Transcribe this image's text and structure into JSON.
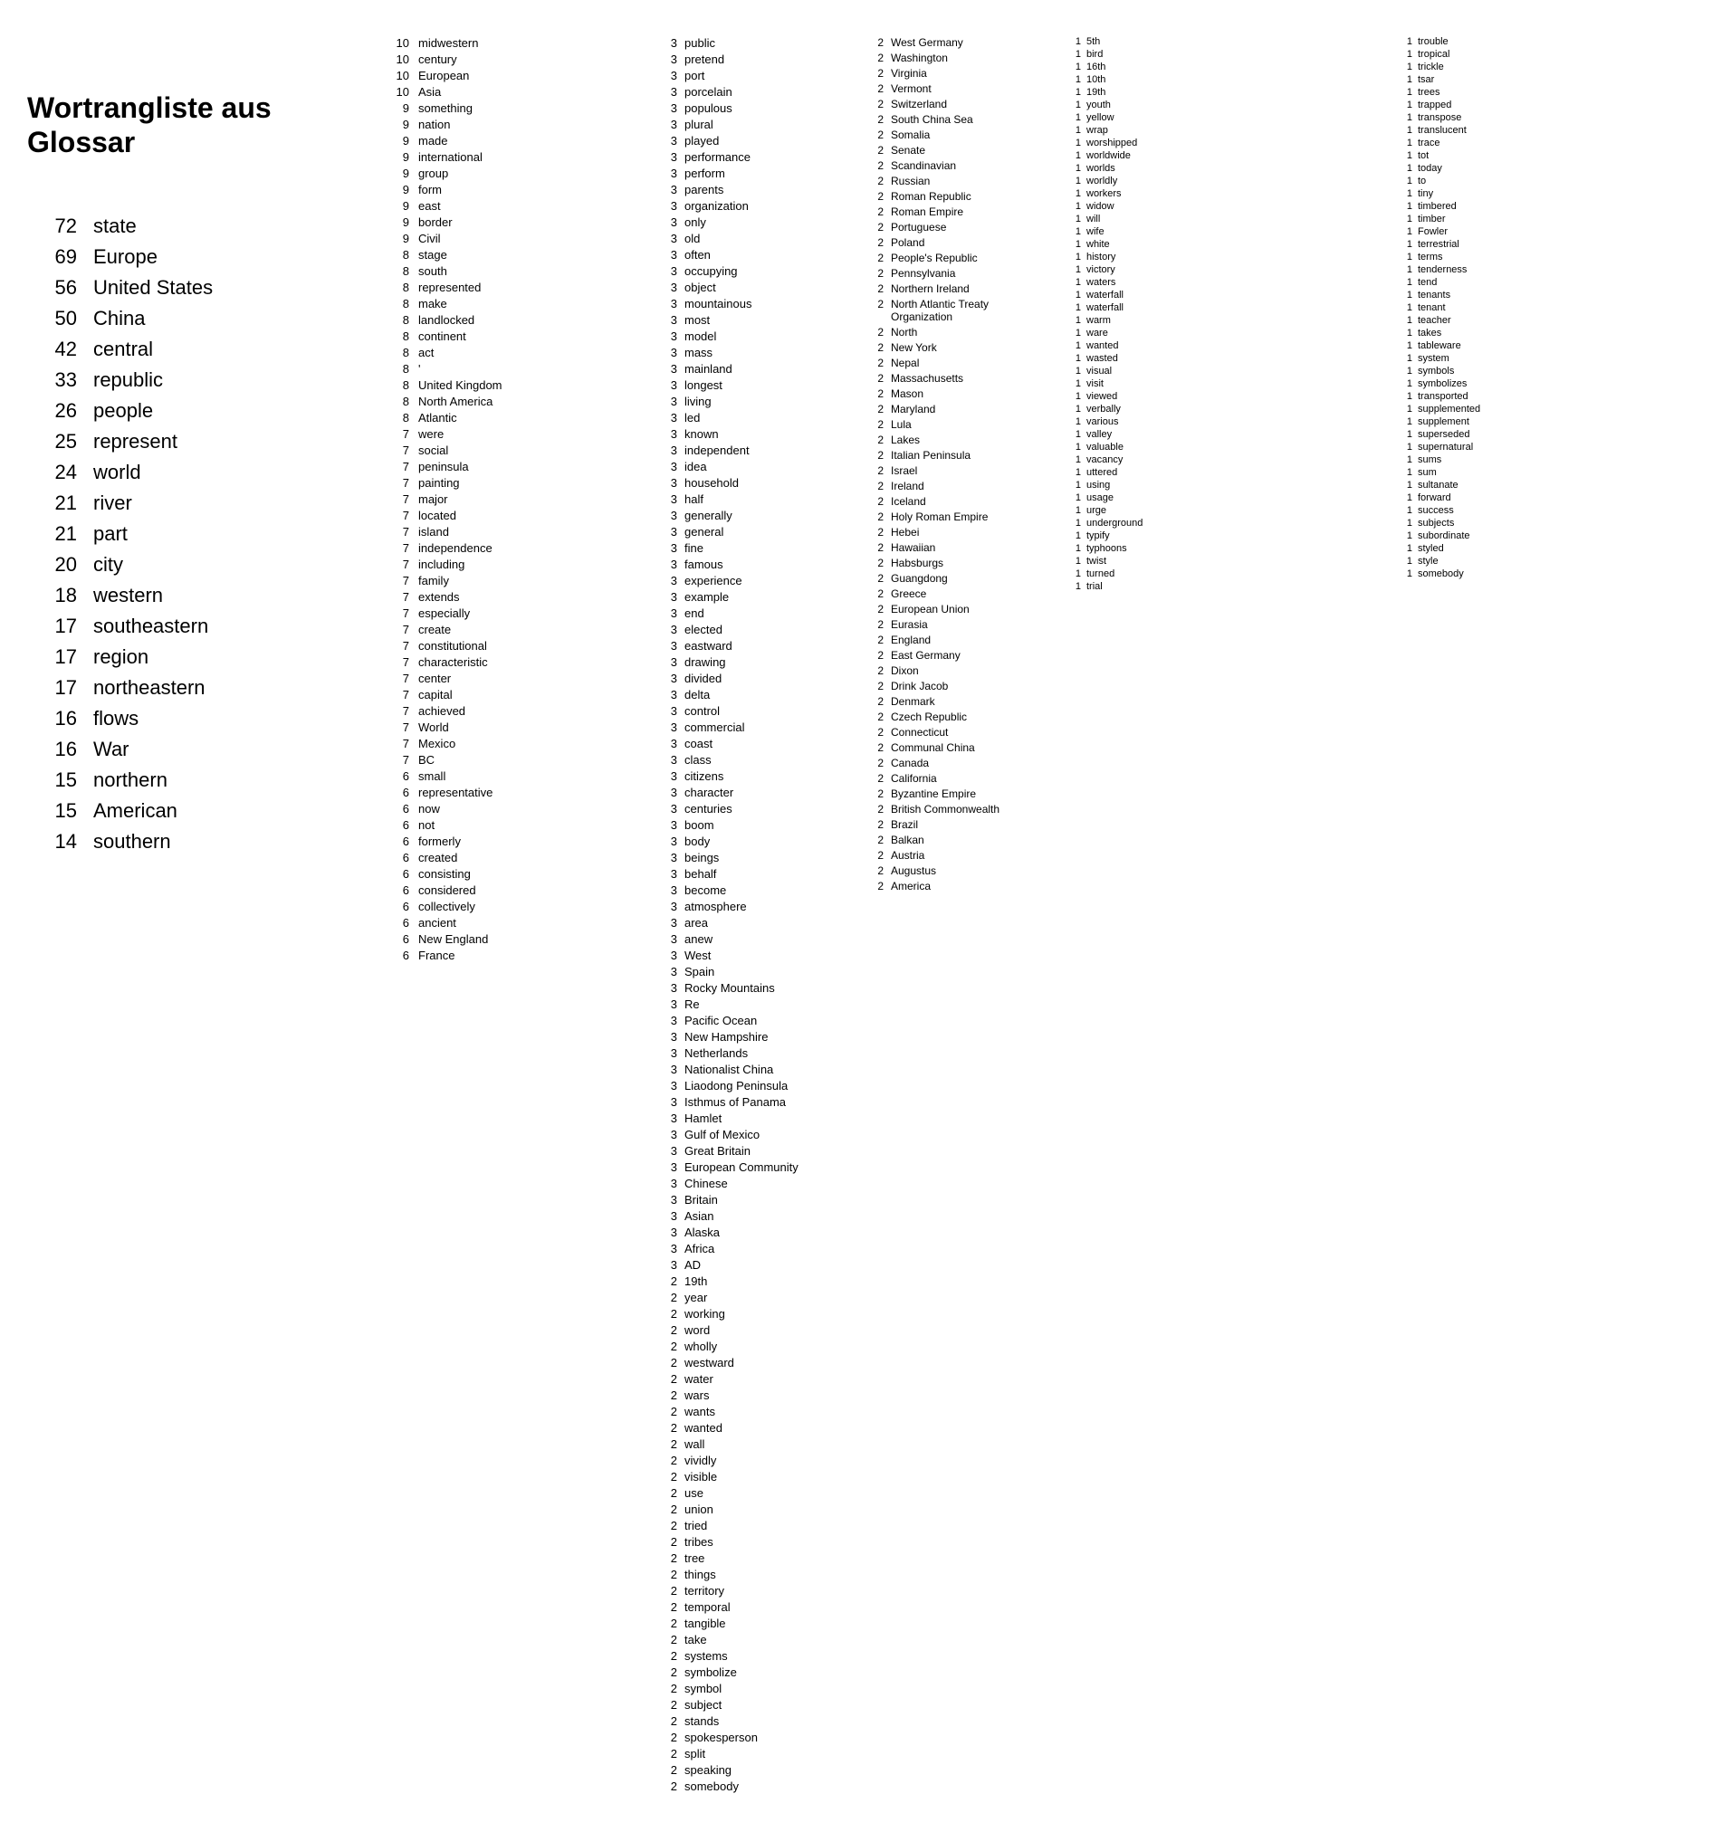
{
  "title": "Wortrangliste aus Glossar",
  "mainList": [
    {
      "count": "72",
      "word": "state"
    },
    {
      "count": "69",
      "word": "Europe"
    },
    {
      "count": "56",
      "word": "United States"
    },
    {
      "count": "50",
      "word": "China"
    },
    {
      "count": "42",
      "word": "central"
    },
    {
      "count": "33",
      "word": "republic"
    },
    {
      "count": "26",
      "word": "people"
    },
    {
      "count": "25",
      "word": "represent"
    },
    {
      "count": "24",
      "word": "world"
    },
    {
      "count": "21",
      "word": "river"
    },
    {
      "count": "21",
      "word": "part"
    },
    {
      "count": "20",
      "word": "city"
    },
    {
      "count": "18",
      "word": "western"
    },
    {
      "count": "17",
      "word": "southeastern"
    },
    {
      "count": "17",
      "word": "region"
    },
    {
      "count": "17",
      "word": "northeastern"
    },
    {
      "count": "16",
      "word": "flows"
    },
    {
      "count": "16",
      "word": "War"
    },
    {
      "count": "15",
      "word": "northern"
    },
    {
      "count": "15",
      "word": "American"
    },
    {
      "count": "14",
      "word": "southern"
    }
  ],
  "middleList": [
    {
      "count": "10",
      "word": "midwestern"
    },
    {
      "count": "10",
      "word": "century"
    },
    {
      "count": "10",
      "word": "European"
    },
    {
      "count": "10",
      "word": "Asia"
    },
    {
      "count": "9",
      "word": "something"
    },
    {
      "count": "9",
      "word": "nation"
    },
    {
      "count": "9",
      "word": "made"
    },
    {
      "count": "9",
      "word": "international"
    },
    {
      "count": "9",
      "word": "group"
    },
    {
      "count": "9",
      "word": "form"
    },
    {
      "count": "9",
      "word": "east"
    },
    {
      "count": "9",
      "word": "border"
    },
    {
      "count": "9",
      "word": "Civil"
    },
    {
      "count": "8",
      "word": "stage"
    },
    {
      "count": "8",
      "word": "south"
    },
    {
      "count": "8",
      "word": "represented"
    },
    {
      "count": "8",
      "word": "make"
    },
    {
      "count": "8",
      "word": "landlocked"
    },
    {
      "count": "8",
      "word": "continent"
    },
    {
      "count": "8",
      "word": "act"
    },
    {
      "count": "8",
      "word": "'"
    },
    {
      "count": "8",
      "word": "United Kingdom"
    },
    {
      "count": "8",
      "word": "North America"
    },
    {
      "count": "8",
      "word": "Atlantic"
    },
    {
      "count": "7",
      "word": "were"
    },
    {
      "count": "7",
      "word": "social"
    },
    {
      "count": "7",
      "word": "peninsula"
    },
    {
      "count": "7",
      "word": "painting"
    },
    {
      "count": "7",
      "word": "major"
    },
    {
      "count": "7",
      "word": "located"
    },
    {
      "count": "7",
      "word": "island"
    },
    {
      "count": "7",
      "word": "independence"
    },
    {
      "count": "7",
      "word": "including"
    },
    {
      "count": "7",
      "word": "family"
    },
    {
      "count": "7",
      "word": "extends"
    },
    {
      "count": "7",
      "word": "especially"
    },
    {
      "count": "7",
      "word": "create"
    },
    {
      "count": "7",
      "word": "constitutional"
    },
    {
      "count": "7",
      "word": "characteristic"
    },
    {
      "count": "7",
      "word": "center"
    },
    {
      "count": "7",
      "word": "capital"
    },
    {
      "count": "7",
      "word": "achieved"
    },
    {
      "count": "7",
      "word": "World"
    },
    {
      "count": "7",
      "word": "Mexico"
    },
    {
      "count": "7",
      "word": "BC"
    },
    {
      "count": "6",
      "word": "small"
    },
    {
      "count": "6",
      "word": "representative"
    },
    {
      "count": "6",
      "word": "now"
    },
    {
      "count": "6",
      "word": "not"
    },
    {
      "count": "6",
      "word": "formerly"
    },
    {
      "count": "6",
      "word": "created"
    },
    {
      "count": "6",
      "word": "consisting"
    },
    {
      "count": "6",
      "word": "considered"
    },
    {
      "count": "6",
      "word": "collectively"
    },
    {
      "count": "6",
      "word": "ancient"
    },
    {
      "count": "6",
      "word": "New England"
    },
    {
      "count": "6",
      "word": "France"
    }
  ],
  "col1List": [
    {
      "count": "3",
      "word": "public"
    },
    {
      "count": "3",
      "word": "pretend"
    },
    {
      "count": "3",
      "word": "port"
    },
    {
      "count": "3",
      "word": "porcelain"
    },
    {
      "count": "3",
      "word": "populous"
    },
    {
      "count": "3",
      "word": "plural"
    },
    {
      "count": "3",
      "word": "played"
    },
    {
      "count": "3",
      "word": "performance"
    },
    {
      "count": "3",
      "word": "perform"
    },
    {
      "count": "3",
      "word": "parents"
    },
    {
      "count": "3",
      "word": "organization"
    },
    {
      "count": "3",
      "word": "only"
    },
    {
      "count": "3",
      "word": "old"
    },
    {
      "count": "3",
      "word": "often"
    },
    {
      "count": "3",
      "word": "occupying"
    },
    {
      "count": "3",
      "word": "object"
    },
    {
      "count": "3",
      "word": "mountainous"
    },
    {
      "count": "3",
      "word": "most"
    },
    {
      "count": "3",
      "word": "model"
    },
    {
      "count": "3",
      "word": "mass"
    },
    {
      "count": "3",
      "word": "mainland"
    },
    {
      "count": "3",
      "word": "longest"
    },
    {
      "count": "3",
      "word": "living"
    },
    {
      "count": "3",
      "word": "led"
    },
    {
      "count": "3",
      "word": "known"
    },
    {
      "count": "3",
      "word": "independent"
    },
    {
      "count": "3",
      "word": "idea"
    },
    {
      "count": "3",
      "word": "household"
    },
    {
      "count": "3",
      "word": "half"
    },
    {
      "count": "3",
      "word": "generally"
    },
    {
      "count": "3",
      "word": "general"
    },
    {
      "count": "3",
      "word": "fine"
    },
    {
      "count": "3",
      "word": "famous"
    },
    {
      "count": "3",
      "word": "experience"
    },
    {
      "count": "3",
      "word": "example"
    },
    {
      "count": "3",
      "word": "end"
    },
    {
      "count": "3",
      "word": "elected"
    },
    {
      "count": "3",
      "word": "eastward"
    },
    {
      "count": "3",
      "word": "drawing"
    },
    {
      "count": "3",
      "word": "divided"
    },
    {
      "count": "3",
      "word": "delta"
    },
    {
      "count": "3",
      "word": "control"
    },
    {
      "count": "3",
      "word": "commercial"
    },
    {
      "count": "3",
      "word": "coast"
    },
    {
      "count": "3",
      "word": "class"
    },
    {
      "count": "3",
      "word": "citizens"
    },
    {
      "count": "3",
      "word": "character"
    },
    {
      "count": "3",
      "word": "centuries"
    },
    {
      "count": "3",
      "word": "boom"
    },
    {
      "count": "3",
      "word": "body"
    },
    {
      "count": "3",
      "word": "beings"
    },
    {
      "count": "3",
      "word": "behalf"
    },
    {
      "count": "3",
      "word": "become"
    },
    {
      "count": "3",
      "word": "atmosphere"
    },
    {
      "count": "3",
      "word": "area"
    },
    {
      "count": "3",
      "word": "anew"
    },
    {
      "count": "3",
      "word": "West"
    },
    {
      "count": "3",
      "word": "Spain"
    },
    {
      "count": "3",
      "word": "Rocky Mountains"
    },
    {
      "count": "3",
      "word": "Re"
    },
    {
      "count": "3",
      "word": "Pacific Ocean"
    },
    {
      "count": "3",
      "word": "New Hampshire"
    },
    {
      "count": "3",
      "word": "Netherlands"
    },
    {
      "count": "3",
      "word": "Nationalist China"
    },
    {
      "count": "3",
      "word": "Liaodong Peninsula"
    },
    {
      "count": "3",
      "word": "Isthmus of Panama"
    },
    {
      "count": "3",
      "word": "Hamlet"
    },
    {
      "count": "3",
      "word": "Gulf of Mexico"
    },
    {
      "count": "3",
      "word": "Great Britain"
    },
    {
      "count": "3",
      "word": "European Community"
    },
    {
      "count": "3",
      "word": "Chinese"
    },
    {
      "count": "3",
      "word": "Britain"
    },
    {
      "count": "3",
      "word": "Asian"
    },
    {
      "count": "3",
      "word": "Alaska"
    },
    {
      "count": "3",
      "word": "Africa"
    },
    {
      "count": "3",
      "word": "AD"
    },
    {
      "count": "2",
      "word": "19th"
    },
    {
      "count": "2",
      "word": "year"
    },
    {
      "count": "2",
      "word": "working"
    },
    {
      "count": "2",
      "word": "word"
    },
    {
      "count": "2",
      "word": "wholly"
    },
    {
      "count": "2",
      "word": "westward"
    },
    {
      "count": "2",
      "word": "water"
    },
    {
      "count": "2",
      "word": "wars"
    },
    {
      "count": "2",
      "word": "wants"
    },
    {
      "count": "2",
      "word": "wanted"
    },
    {
      "count": "2",
      "word": "wall"
    },
    {
      "count": "2",
      "word": "vividly"
    },
    {
      "count": "2",
      "word": "visible"
    },
    {
      "count": "2",
      "word": "use"
    },
    {
      "count": "2",
      "word": "union"
    },
    {
      "count": "2",
      "word": "tried"
    },
    {
      "count": "2",
      "word": "tribes"
    },
    {
      "count": "2",
      "word": "tree"
    },
    {
      "count": "2",
      "word": "things"
    },
    {
      "count": "2",
      "word": "territory"
    },
    {
      "count": "2",
      "word": "temporal"
    },
    {
      "count": "2",
      "word": "tangible"
    },
    {
      "count": "2",
      "word": "take"
    },
    {
      "count": "2",
      "word": "systems"
    },
    {
      "count": "2",
      "word": "symbolize"
    },
    {
      "count": "2",
      "word": "symbol"
    },
    {
      "count": "2",
      "word": "subject"
    },
    {
      "count": "2",
      "word": "stands"
    },
    {
      "count": "2",
      "word": "spokesperson"
    },
    {
      "count": "2",
      "word": "split"
    },
    {
      "count": "2",
      "word": "speaking"
    },
    {
      "count": "2",
      "word": "somebody"
    }
  ],
  "col2List": [
    {
      "count": "2",
      "word": "West Germany"
    },
    {
      "count": "2",
      "word": "Washington"
    },
    {
      "count": "2",
      "word": "Virginia"
    },
    {
      "count": "2",
      "word": "Vermont"
    },
    {
      "count": "2",
      "word": "Switzerland"
    },
    {
      "count": "2",
      "word": "South China Sea"
    },
    {
      "count": "2",
      "word": "Somalia"
    },
    {
      "count": "2",
      "word": "Senate"
    },
    {
      "count": "2",
      "word": "Scandinavian"
    },
    {
      "count": "2",
      "word": "Russian"
    },
    {
      "count": "2",
      "word": "Roman Republic"
    },
    {
      "count": "2",
      "word": "Roman Empire"
    },
    {
      "count": "2",
      "word": "Portuguese"
    },
    {
      "count": "2",
      "word": "Poland"
    },
    {
      "count": "2",
      "word": "People's Republic"
    },
    {
      "count": "2",
      "word": "Pennsylvania"
    },
    {
      "count": "2",
      "word": "Northern Ireland"
    },
    {
      "count": "2",
      "word": "North Atlantic Treaty Organization"
    },
    {
      "count": "2",
      "word": "North"
    },
    {
      "count": "2",
      "word": "New York"
    },
    {
      "count": "2",
      "word": "Nepal"
    },
    {
      "count": "2",
      "word": "Massachusetts"
    },
    {
      "count": "2",
      "word": "Mason"
    },
    {
      "count": "2",
      "word": "Maryland"
    },
    {
      "count": "2",
      "word": "Lula"
    },
    {
      "count": "2",
      "word": "Lakes"
    },
    {
      "count": "2",
      "word": "Italian Peninsula"
    },
    {
      "count": "2",
      "word": "Israel"
    },
    {
      "count": "2",
      "word": "Ireland"
    },
    {
      "count": "2",
      "word": "Iceland"
    },
    {
      "count": "2",
      "word": "Holy Roman Empire"
    },
    {
      "count": "2",
      "word": "Hebei"
    },
    {
      "count": "2",
      "word": "Hawaiian"
    },
    {
      "count": "2",
      "word": "Habsburgs"
    },
    {
      "count": "2",
      "word": "Guangdong"
    },
    {
      "count": "2",
      "word": "Greece"
    },
    {
      "count": "2",
      "word": "European Union"
    },
    {
      "count": "2",
      "word": "Eurasia"
    },
    {
      "count": "2",
      "word": "England"
    },
    {
      "count": "2",
      "word": "East Germany"
    },
    {
      "count": "2",
      "word": "Dixon"
    },
    {
      "count": "2",
      "word": "Drink Jacob"
    },
    {
      "count": "2",
      "word": "Denmark"
    },
    {
      "count": "2",
      "word": "Czech Republic"
    },
    {
      "count": "2",
      "word": "Connecticut"
    },
    {
      "count": "2",
      "word": "Communal China"
    },
    {
      "count": "2",
      "word": "Canada"
    },
    {
      "count": "2",
      "word": "California"
    },
    {
      "count": "2",
      "word": "Byzantine Empire"
    },
    {
      "count": "2",
      "word": "British Commonwealth"
    },
    {
      "count": "2",
      "word": "Brazil"
    },
    {
      "count": "2",
      "word": "Balkan"
    },
    {
      "count": "2",
      "word": "Austria"
    },
    {
      "count": "2",
      "word": "Augustus"
    },
    {
      "count": "2",
      "word": "America"
    }
  ],
  "farRightList": [
    {
      "count": "1",
      "word": "5th"
    },
    {
      "count": "1",
      "word": "bird"
    },
    {
      "count": "1",
      "word": "16th"
    },
    {
      "count": "1",
      "word": "10th"
    },
    {
      "count": "1",
      "word": "19th"
    },
    {
      "count": "1",
      "word": "youth"
    },
    {
      "count": "1",
      "word": "yellow"
    },
    {
      "count": "1",
      "word": "wrap"
    },
    {
      "count": "1",
      "word": "worshipped"
    },
    {
      "count": "1",
      "word": "worldwide"
    },
    {
      "count": "1",
      "word": "worlds"
    },
    {
      "count": "1",
      "word": "worldly"
    },
    {
      "count": "1",
      "word": "workers"
    },
    {
      "count": "1",
      "word": "widow"
    },
    {
      "count": "1",
      "word": "will"
    },
    {
      "count": "1",
      "word": "wife"
    },
    {
      "count": "1",
      "word": "white"
    },
    {
      "count": "1",
      "word": "history"
    },
    {
      "count": "1",
      "word": "victory"
    },
    {
      "count": "1",
      "word": "waters"
    },
    {
      "count": "1",
      "word": "waterfall"
    },
    {
      "count": "1",
      "word": "waterfall"
    },
    {
      "count": "1",
      "word": "warm"
    },
    {
      "count": "1",
      "word": "ware"
    },
    {
      "count": "1",
      "word": "wanted"
    },
    {
      "count": "1",
      "word": "wasted"
    },
    {
      "count": "1",
      "word": "visual"
    },
    {
      "count": "1",
      "word": "visit"
    },
    {
      "count": "1",
      "word": "viewed"
    },
    {
      "count": "1",
      "word": "verbally"
    },
    {
      "count": "1",
      "word": "various"
    },
    {
      "count": "1",
      "word": "valley"
    },
    {
      "count": "1",
      "word": "valuable"
    },
    {
      "count": "1",
      "word": "vacancy"
    },
    {
      "count": "1",
      "word": "uttered"
    },
    {
      "count": "1",
      "word": "using"
    },
    {
      "count": "1",
      "word": "usage"
    },
    {
      "count": "1",
      "word": "urge"
    },
    {
      "count": "1",
      "word": "underground"
    },
    {
      "count": "1",
      "word": "typify"
    },
    {
      "count": "1",
      "word": "typhoons"
    },
    {
      "count": "1",
      "word": "twist"
    },
    {
      "count": "1",
      "word": "turned"
    },
    {
      "count": "1",
      "word": "trial"
    },
    {
      "count": "1",
      "word": "trouble"
    },
    {
      "count": "1",
      "word": "tropical"
    },
    {
      "count": "1",
      "word": "trickle"
    },
    {
      "count": "1",
      "word": "tsar"
    },
    {
      "count": "1",
      "word": "trees"
    },
    {
      "count": "1",
      "word": "trapped"
    },
    {
      "count": "1",
      "word": "transpose"
    },
    {
      "count": "1",
      "word": "translucent"
    },
    {
      "count": "1",
      "word": "trace"
    },
    {
      "count": "1",
      "word": "tot"
    },
    {
      "count": "1",
      "word": "today"
    },
    {
      "count": "1",
      "word": "to"
    },
    {
      "count": "1",
      "word": "tiny"
    },
    {
      "count": "1",
      "word": "timbered"
    },
    {
      "count": "1",
      "word": "timber"
    },
    {
      "count": "1",
      "word": "Fowler"
    },
    {
      "count": "1",
      "word": "terrestrial"
    },
    {
      "count": "1",
      "word": "terms"
    },
    {
      "count": "1",
      "word": "tenderness"
    },
    {
      "count": "1",
      "word": "tend"
    },
    {
      "count": "1",
      "word": "tenants"
    },
    {
      "count": "1",
      "word": "tenant"
    },
    {
      "count": "1",
      "word": "teacher"
    },
    {
      "count": "1",
      "word": "takes"
    },
    {
      "count": "1",
      "word": "tableware"
    },
    {
      "count": "1",
      "word": "system"
    },
    {
      "count": "1",
      "word": "symbols"
    },
    {
      "count": "1",
      "word": "symbolizes"
    },
    {
      "count": "1",
      "word": "transported"
    },
    {
      "count": "1",
      "word": "supplemented"
    },
    {
      "count": "1",
      "word": "supplement"
    },
    {
      "count": "1",
      "word": "superseded"
    },
    {
      "count": "1",
      "word": "supernatural"
    },
    {
      "count": "1",
      "word": "sums"
    },
    {
      "count": "1",
      "word": "sum"
    },
    {
      "count": "1",
      "word": "sultanate"
    },
    {
      "count": "1",
      "word": "forward"
    },
    {
      "count": "1",
      "word": "success"
    },
    {
      "count": "1",
      "word": "subjects"
    },
    {
      "count": "1",
      "word": "subordinate"
    },
    {
      "count": "1",
      "word": "styled"
    },
    {
      "count": "1",
      "word": "style"
    },
    {
      "count": "1",
      "word": "somebody"
    }
  ]
}
